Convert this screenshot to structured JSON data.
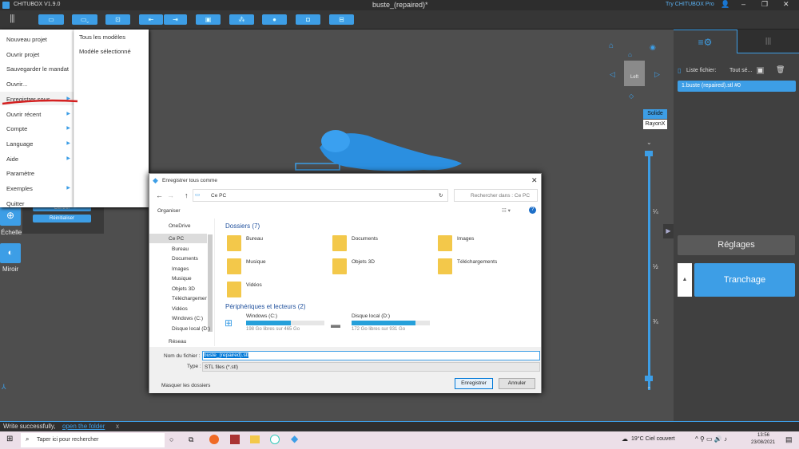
{
  "app": {
    "title": "CHITUBOX V1.9.0",
    "doc_title": "buste_(repaired)*",
    "try_pro": "Try CHITUBOX Pro"
  },
  "toolbar": {
    "icons": [
      "open-folder-icon",
      "save-icon",
      "import-icon",
      "undo-icon",
      "redo-icon",
      "layout-icon",
      "tree-icon",
      "support-icon",
      "hollow-icon",
      "crop-icon"
    ]
  },
  "menu": {
    "items": [
      {
        "label": "Nouveau projet"
      },
      {
        "label": "Ouvrir projet"
      },
      {
        "label": "Sauvegarder le mandat"
      },
      {
        "label": "Ouvrir..."
      },
      {
        "label": "Enregistrer sous...",
        "arrow": true
      },
      {
        "label": "Ouvrir récent",
        "arrow": true
      },
      {
        "label": "Compte",
        "arrow": true
      },
      {
        "label": "Language",
        "arrow": true
      },
      {
        "label": "Aide",
        "arrow": true
      },
      {
        "label": "Paramètre"
      },
      {
        "label": "Exemples",
        "arrow": true
      },
      {
        "label": "Quitter"
      }
    ],
    "submenu": [
      "Tous les modèles",
      "Modèle sélectionné"
    ]
  },
  "left_tools": {
    "scale": "Échelle",
    "mirror": "Miroir",
    "center": "Centrer",
    "reset": "Réinitialiser"
  },
  "view": {
    "cube_face": "Left",
    "solid": "Solide",
    "xray": "RayonX"
  },
  "slider": {
    "ticks": [
      "¼",
      "½",
      "¾"
    ]
  },
  "right_panel": {
    "file_list_label": "Liste fichier:",
    "select_all": "Tout sé...",
    "files": [
      "1.buste (repaired).stl #0"
    ],
    "settings": "Réglages",
    "slice": "Tranchage"
  },
  "dialog": {
    "title": "Enregistrer tous comme",
    "path": "Ce PC",
    "search_placeholder": "Rechercher dans : Ce PC",
    "organize": "Organiser",
    "nav": [
      "OneDrive",
      "Ce PC",
      "Bureau",
      "Documents",
      "Images",
      "Musique",
      "Objets 3D",
      "Téléchargements",
      "Vidéos",
      "Windows (C:)",
      "Disque local (D:)",
      "Réseau"
    ],
    "folders_header": "Dossiers (7)",
    "folders": [
      "Bureau",
      "Documents",
      "Images",
      "Musique",
      "Objets 3D",
      "Téléchargements",
      "Vidéos"
    ],
    "drives_header": "Périphériques et lecteurs (2)",
    "drives": [
      {
        "name": "Windows (C:)",
        "free": "198 Go libres sur 465 Go",
        "used_fraction": 0.57
      },
      {
        "name": "Disque local (D:)",
        "free": "172 Go libres sur 931 Go",
        "used_fraction": 0.82
      }
    ],
    "filename_label": "Nom du fichier :",
    "filename": "buste_(repaired).stl",
    "type_label": "Type :",
    "type": "STL files (*.stl)",
    "hide_folders": "Masquer les dossiers",
    "save": "Enregistrer",
    "cancel": "Annuler"
  },
  "status": {
    "message": "Write successfully,",
    "link": "open the folder",
    "close": "x"
  },
  "taskbar": {
    "search_placeholder": "Taper ici pour rechercher",
    "weather": "19°C Ciel couvert",
    "time": "13:56",
    "date": "23/08/2021"
  },
  "colors": {
    "accent": "#3d9ee6",
    "annotation": "#d42020"
  }
}
